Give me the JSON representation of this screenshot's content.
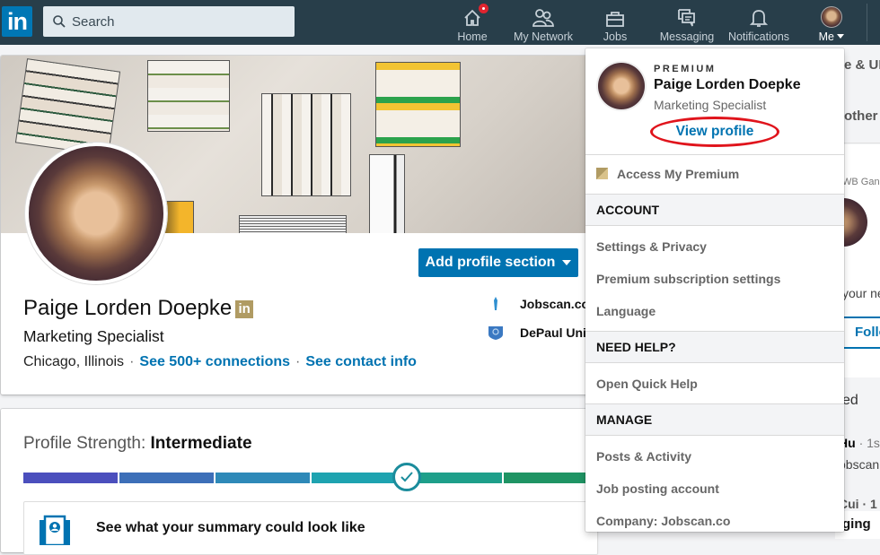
{
  "topbar": {
    "logo": "in",
    "search_placeholder": "Search",
    "nav": [
      {
        "label": "Home",
        "icon": "home-icon",
        "has_badge": true
      },
      {
        "label": "My Network",
        "icon": "network-icon"
      },
      {
        "label": "Jobs",
        "icon": "briefcase-icon"
      },
      {
        "label": "Messaging",
        "icon": "messaging-icon"
      },
      {
        "label": "Notifications",
        "icon": "bell-icon"
      },
      {
        "label": "Me",
        "icon": "avatar"
      }
    ]
  },
  "profile": {
    "name": "Paige Lorden Doepke",
    "premium_badge": "in",
    "headline": "Marketing Specialist",
    "location": "Chicago, Illinois",
    "connections_link": "See 500+ connections",
    "contact_link": "See contact info",
    "separator": "·",
    "add_section_button": "Add profile section",
    "experience": [
      {
        "label": "Jobscan.co",
        "icon": "jobscan-logo-icon"
      },
      {
        "label": "DePaul Univ",
        "icon": "depaul-logo-icon"
      }
    ]
  },
  "strength": {
    "label": "Profile Strength:",
    "level": "Intermediate",
    "progress_steps_completed": 4,
    "progress_steps_total": 7,
    "segment_colors": [
      "#4b4fbd",
      "#3d6fb8",
      "#2e89b8",
      "#1ea3b0",
      "#1e9f8a",
      "#1f9464",
      "#2a8c46"
    ],
    "summary_prompt": "See what your summary could look like"
  },
  "right_column": {
    "fragments": [
      "e & UR",
      "other",
      "WB Gan",
      "your ne",
      "Follo",
      "ed",
      "Hu",
      "· 1s",
      "obscan",
      "Cui · 1",
      "ging"
    ]
  },
  "dropdown": {
    "premium_label": "PREMIUM",
    "name": "Paige Lorden Doepke",
    "title": "Marketing Specialist",
    "view_profile": "View profile",
    "access_premium": "Access My Premium",
    "sections": [
      {
        "header": "ACCOUNT",
        "items": [
          "Settings & Privacy",
          "Premium subscription settings",
          "Language"
        ]
      },
      {
        "header": "NEED HELP?",
        "items": [
          "Open Quick Help"
        ]
      },
      {
        "header": "MANAGE",
        "items": [
          "Posts & Activity",
          "Job posting account",
          "Company: Jobscan.co"
        ]
      }
    ]
  }
}
